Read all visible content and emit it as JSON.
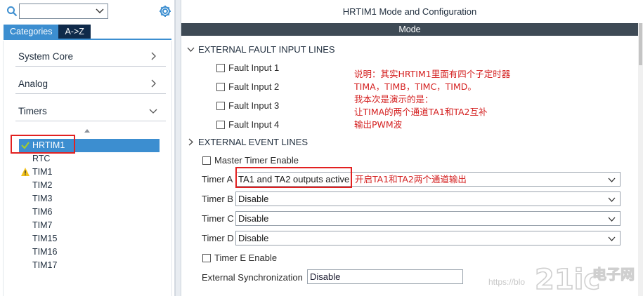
{
  "left_panel": {
    "search": {
      "value": ""
    },
    "tabs": {
      "categories": "Categories",
      "az": "A->Z"
    },
    "categories": [
      {
        "label": "System Core"
      },
      {
        "label": "Analog"
      },
      {
        "label": "Timers"
      }
    ],
    "peripherals": [
      {
        "label": "HRTIM1",
        "status": "check",
        "selected": true
      },
      {
        "label": "RTC",
        "status": "none"
      },
      {
        "label": "TIM1",
        "status": "warning"
      },
      {
        "label": "TIM2",
        "status": "none"
      },
      {
        "label": "TIM3",
        "status": "none"
      },
      {
        "label": "TIM6",
        "status": "none"
      },
      {
        "label": "TIM7",
        "status": "none"
      },
      {
        "label": "TIM15",
        "status": "none"
      },
      {
        "label": "TIM16",
        "status": "none"
      },
      {
        "label": "TIM17",
        "status": "none"
      }
    ]
  },
  "right_panel": {
    "title": "HRTIM1 Mode and Configuration",
    "mode_header": "Mode",
    "fault_section": {
      "label": "EXTERNAL FAULT INPUT LINES",
      "items": [
        "Fault Input 1",
        "Fault Input 2",
        "Fault Input 3",
        "Fault Input 4"
      ]
    },
    "event_section": {
      "label": "EXTERNAL EVENT LINES"
    },
    "master_timer": "Master Timer Enable",
    "timers": [
      {
        "label": "Timer A",
        "value": "TA1 and TA2 outputs active"
      },
      {
        "label": "Timer B",
        "value": "Disable"
      },
      {
        "label": "Timer C",
        "value": "Disable"
      },
      {
        "label": "Timer D",
        "value": "Disable"
      }
    ],
    "timer_e": "Timer E Enable",
    "external_sync": {
      "label": "External Synchronization",
      "value": "Disable"
    }
  },
  "annotations": {
    "note_lines": [
      "说明：其实HRTIM1里面有四个子定时器",
      "TIMA，TIMB，TIMC，TIMD。",
      "我本次是演示的是：",
      "让TIMA的两个通道TA1和TA2互补",
      "输出PWM波"
    ],
    "timer_a_note": "开启TA1和TA2两个通道输出"
  },
  "watermark": {
    "url": "https://blo",
    "brand": "21ic电子网"
  },
  "colors": {
    "accent": "#3c8ed0",
    "tab_dark": "#0f2a4a",
    "mode_bar": "#3e4a55",
    "annotation": "#e22020"
  }
}
